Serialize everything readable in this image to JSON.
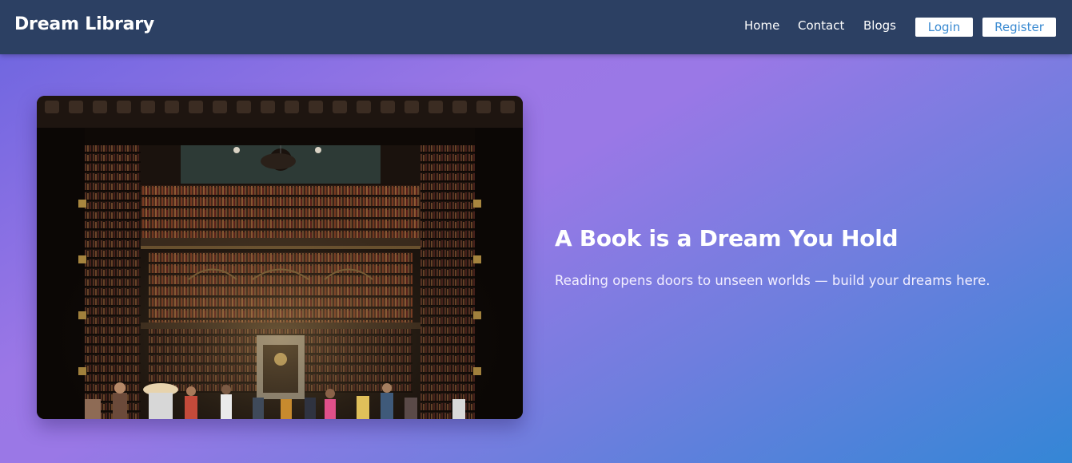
{
  "nav": {
    "brand": "Dream Library",
    "links": [
      "Home",
      "Contact",
      "Blogs"
    ],
    "login_label": "Login",
    "register_label": "Register"
  },
  "hero": {
    "title": "A Book is a Dream You Hold",
    "subtitle": "Reading opens doors to unseen worlds — build your dreams here.",
    "image_icon": "library-interior-photo"
  },
  "colors": {
    "navbar": "#2c4063",
    "button_text": "#3a8ad1",
    "gradient_start": "#6a64df",
    "gradient_mid": "#9b77e6",
    "gradient_end": "#3486d6"
  }
}
